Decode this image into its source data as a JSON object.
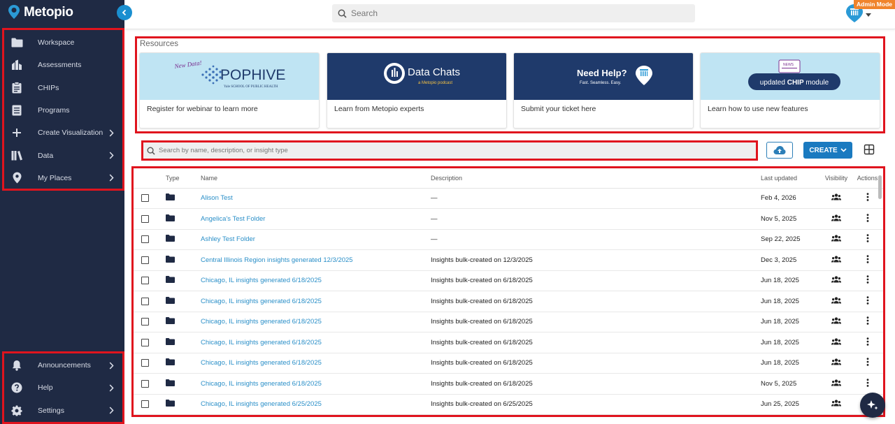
{
  "brand": {
    "name": "Metopio",
    "logo_icon": "metopio-pin-icon"
  },
  "sidebar": {
    "top_items": [
      {
        "label": "Workspace",
        "icon": "folder-icon",
        "has_submenu": false
      },
      {
        "label": "Assessments",
        "icon": "assessment-icon",
        "has_submenu": false
      },
      {
        "label": "CHIPs",
        "icon": "clipboard-icon",
        "has_submenu": false
      },
      {
        "label": "Programs",
        "icon": "program-icon",
        "has_submenu": false
      },
      {
        "label": "Create Visualization",
        "icon": "plus-icon",
        "has_submenu": true
      },
      {
        "label": "Data",
        "icon": "library-icon",
        "has_submenu": true
      },
      {
        "label": "My Places",
        "icon": "map-pin-icon",
        "has_submenu": true
      }
    ],
    "bottom_items": [
      {
        "label": "Announcements",
        "icon": "bell-icon",
        "has_submenu": true
      },
      {
        "label": "Help",
        "icon": "help-icon",
        "has_submenu": true
      },
      {
        "label": "Settings",
        "icon": "gear-icon",
        "has_submenu": true
      }
    ]
  },
  "topbar": {
    "search_placeholder": "Search",
    "admin_badge": "Admin Mode"
  },
  "resources": {
    "title": "Resources",
    "cards": [
      {
        "banner_text": "POPHIVE",
        "banner_tag": "New Data!",
        "banner_sub": "Yale SCHOOL OF PUBLIC HEALTH",
        "caption": "Register for webinar to learn more"
      },
      {
        "banner_text": "Data Chats",
        "banner_sub": "a Metopio podcast",
        "caption": "Learn from Metopio experts"
      },
      {
        "banner_text": "Need Help?",
        "banner_sub": "Fast. Seamless. Easy.",
        "caption": "Submit your ticket here"
      },
      {
        "banner_text_pre": "updated ",
        "banner_text_bold": "CHIP",
        "banner_text_post": " module",
        "banner_tag": "NEWS",
        "caption": "Learn how to use new features"
      }
    ]
  },
  "list": {
    "search_placeholder": "Search by name, description, or insight type",
    "create_label": "CREATE",
    "columns": [
      "Type",
      "Name",
      "Description",
      "Last updated",
      "Visibility",
      "Actions"
    ],
    "rows": [
      {
        "name": "Alison Test",
        "description": "—",
        "updated": "Feb 4, 2026"
      },
      {
        "name": "Angelica's Test Folder",
        "description": "—",
        "updated": "Nov 5, 2025"
      },
      {
        "name": "Ashley Test Folder",
        "description": "—",
        "updated": "Sep 22, 2025"
      },
      {
        "name": "Central Illinois Region insights generated 12/3/2025",
        "description": "Insights bulk-created on 12/3/2025",
        "updated": "Dec 3, 2025"
      },
      {
        "name": "Chicago, IL insights generated 6/18/2025",
        "description": "Insights bulk-created on 6/18/2025",
        "updated": "Jun 18, 2025"
      },
      {
        "name": "Chicago, IL insights generated 6/18/2025",
        "description": "Insights bulk-created on 6/18/2025",
        "updated": "Jun 18, 2025"
      },
      {
        "name": "Chicago, IL insights generated 6/18/2025",
        "description": "Insights bulk-created on 6/18/2025",
        "updated": "Jun 18, 2025"
      },
      {
        "name": "Chicago, IL insights generated 6/18/2025",
        "description": "Insights bulk-created on 6/18/2025",
        "updated": "Jun 18, 2025"
      },
      {
        "name": "Chicago, IL insights generated 6/18/2025",
        "description": "Insights bulk-created on 6/18/2025",
        "updated": "Jun 18, 2025"
      },
      {
        "name": "Chicago, IL insights generated 6/18/2025",
        "description": "Insights bulk-created on 6/18/2025",
        "updated": "Nov 5, 2025"
      },
      {
        "name": "Chicago, IL insights generated 6/25/2025",
        "description": "Insights bulk-created on 6/25/2025",
        "updated": "Jun 25, 2025"
      }
    ]
  },
  "colors": {
    "sidebar_bg": "#1f2a44",
    "accent": "#1a7ac0",
    "link": "#2a8fc8",
    "admin_badge": "#f0842c",
    "highlight_border": "#e0141e"
  }
}
